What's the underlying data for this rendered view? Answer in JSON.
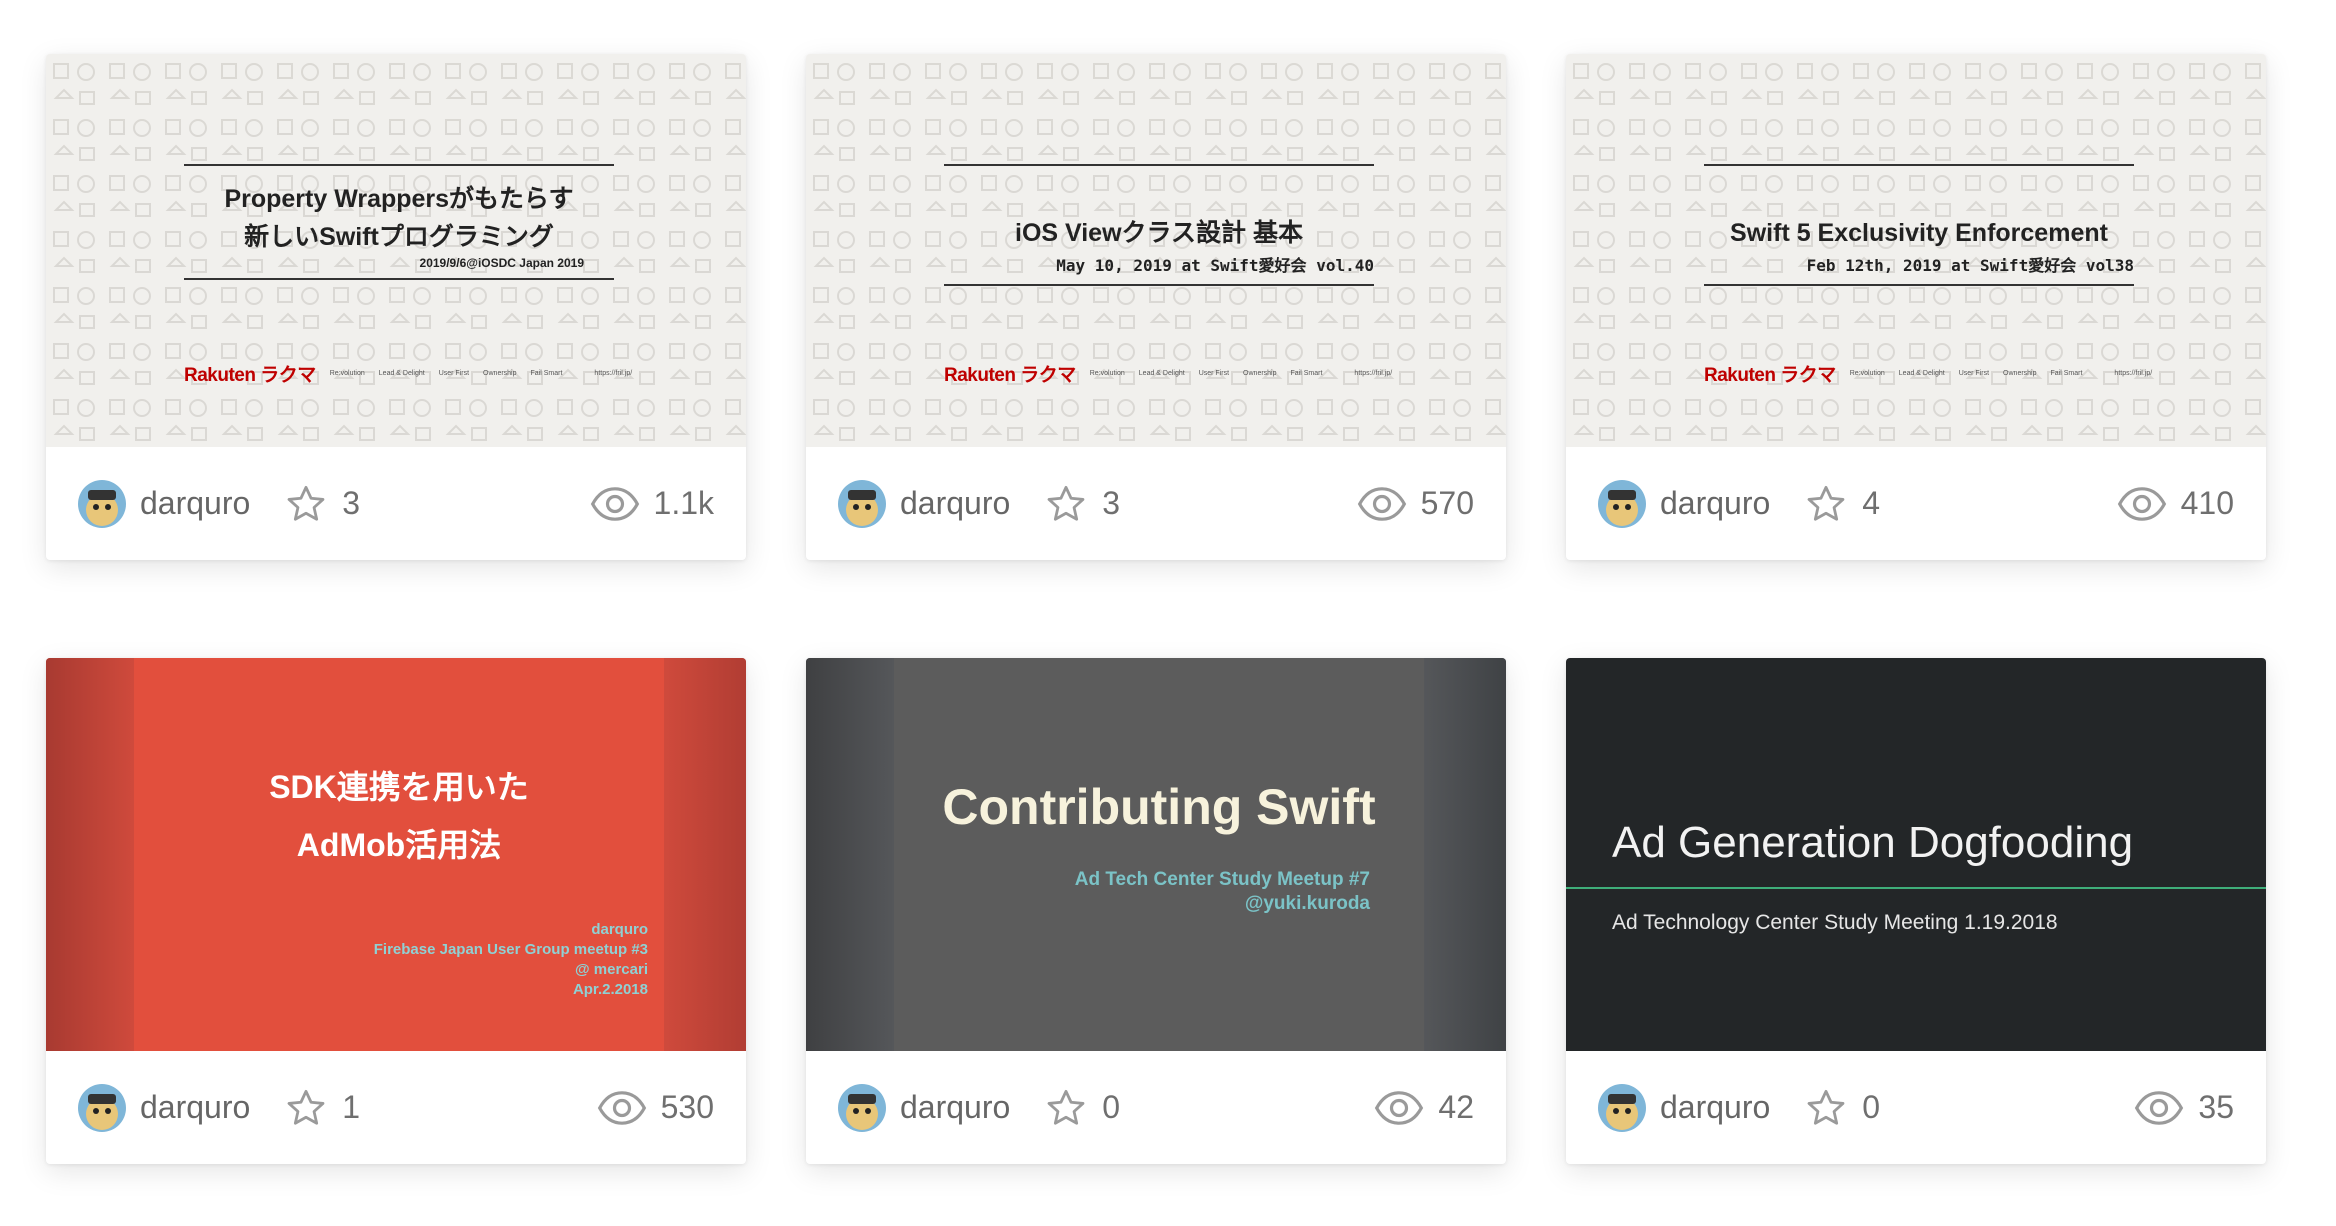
{
  "cards": [
    {
      "slide": {
        "title_line1": "Property Wrappersがもたらす",
        "title_line2": "新しいSwiftプログラミング",
        "subtitle": "2019/9/6@iOSDC Japan 2019"
      },
      "author": "darquro",
      "stars": "3",
      "views": "1.1k"
    },
    {
      "slide": {
        "title_line1": "iOS Viewクラス設計 基本",
        "subtitle": "May 10, 2019 at Swift愛好会 vol.40"
      },
      "author": "darquro",
      "stars": "3",
      "views": "570"
    },
    {
      "slide": {
        "title_line1": "Swift 5 Exclusivity Enforcement",
        "subtitle": "Feb 12th, 2019 at Swift愛好会 vol38"
      },
      "author": "darquro",
      "stars": "4",
      "views": "410"
    },
    {
      "slide": {
        "title_line1": "SDK連携を用いた",
        "title_line2": "AdMob活用法",
        "details": [
          "darquro",
          "Firebase Japan User Group meetup #3",
          "@ mercari",
          "Apr.2.2018"
        ]
      },
      "author": "darquro",
      "stars": "1",
      "views": "530"
    },
    {
      "slide": {
        "title_line1": "Contributing Swift",
        "details": [
          "Ad Tech Center Study Meetup #7",
          "@yuki.kuroda"
        ]
      },
      "author": "darquro",
      "stars": "0",
      "views": "42"
    },
    {
      "slide": {
        "title_line1": "Ad Generation Dogfooding",
        "subtitle": "Ad Technology Center Study Meeting 1.19.2018"
      },
      "author": "darquro",
      "stars": "0",
      "views": "35"
    }
  ],
  "brand": {
    "logo": "Rakuten ラクマ",
    "tags": [
      "Re:volution",
      "Lead & Delight",
      "User First",
      "Ownership",
      "Fail Smart"
    ],
    "url": "https://fril.jp/"
  },
  "colors": {
    "star_icon": "#9a9a9a",
    "text_muted": "#6f6f6f",
    "slide_red": "#e24f3d",
    "slide_grey": "#5c5c5c",
    "slide_dark": "#232628",
    "accent_teal": "#7bc3c7",
    "accent_green": "#3fae7a"
  },
  "icons": {
    "star": "star-icon",
    "views": "eye-icon",
    "avatar": "avatar-icon"
  }
}
